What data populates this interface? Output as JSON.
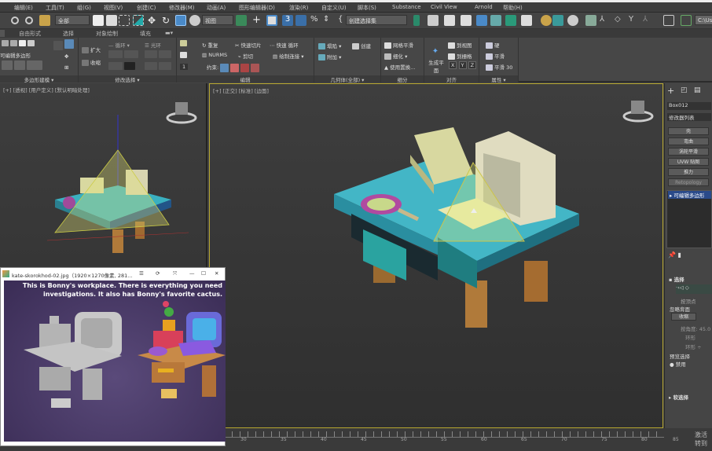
{
  "menu": [
    "编辑(E)",
    "工具(T)",
    "组(G)",
    "视图(V)",
    "创建(C)",
    "修改器(M)",
    "动画(A)",
    "图形编辑器(D)",
    "渲染(R)",
    "自定义(U)",
    "脚本(S)",
    "Substance",
    "Civil View",
    "Arnold",
    "帮助(H)"
  ],
  "toolbar": {
    "selection_filter": "全部",
    "ref_coord": "视图",
    "named_selection": "创建选择集",
    "path_field": "C:\\Us"
  },
  "ribbon_tabs": [
    "自由形式",
    "选择",
    "对象绘制",
    "填充"
  ],
  "ribbon": {
    "poly_modeling": {
      "label": "多边形建模",
      "item": "可编辑多边形"
    },
    "modify_selection": {
      "label": "修改选择",
      "grow": "扩大",
      "shrink": "收缩",
      "loop": "循环",
      "ring": "光环",
      "spinner": "1"
    },
    "edit": {
      "label": "编辑",
      "repeat": "重复",
      "quickslice": "快速切片",
      "quickloop": "快速 循环",
      "nurms": "NURMS",
      "cut": "剪切",
      "swiftloop": "绘制连接",
      "constraint": "约束:"
    },
    "geometry": {
      "label": "几何体(全部)",
      "collapse": "塌陷",
      "attach": "附加",
      "create": "创建"
    },
    "subdivision": {
      "label": "细分",
      "meshsmooth": "网格平滑",
      "tessellate": "细化",
      "use_displacement": "使用置换..."
    },
    "align": {
      "label": "对齐",
      "make_planar": "生成平面",
      "to_view": "到视图",
      "to_grid": "到栅格",
      "x": "X",
      "y": "Y",
      "z": "Z"
    },
    "properties": {
      "label": "属性",
      "hard": "硬",
      "smooth": "平滑",
      "smooth30": "平滑 30"
    }
  },
  "viewports": {
    "left": {
      "label": "[+] [透视] [用户定义] [默认明暗处理]"
    },
    "main": {
      "label": "[+] [正交] [标准] [边面]"
    }
  },
  "command_panel": {
    "object_name": "Box012",
    "modifier_list": "修改器列表",
    "buttons": [
      "壳",
      "弯曲",
      "涡轮平滑",
      "UVW 贴图",
      "推力",
      "Retopology"
    ],
    "stack_item": "可编辑多边形",
    "selection_rollout": "选择",
    "by_vertex": "按顶点",
    "ignore_backfacing": "忽略背面",
    "by_angle": "按角度:",
    "angle_value": "45.0",
    "shrink": "收缩",
    "ring": "环形",
    "soft_selection": "软选择",
    "preview_selection": "预览选择",
    "disable": "禁用",
    "soft_sel_rollout": "软选择",
    "activate1": "激活",
    "activate2": "转到"
  },
  "timeline": {
    "ticks": [
      "30",
      "35",
      "40",
      "45",
      "50",
      "55",
      "60",
      "65",
      "70",
      "75",
      "80",
      "85"
    ]
  },
  "image_viewer": {
    "title": "kate-skorokhod-02.jpg（1920×1270像素, 281...",
    "caption1": "This is Bonny's workplace. There is everything you need",
    "caption2": "investigations. It also has Bonny's favorite cactus."
  }
}
